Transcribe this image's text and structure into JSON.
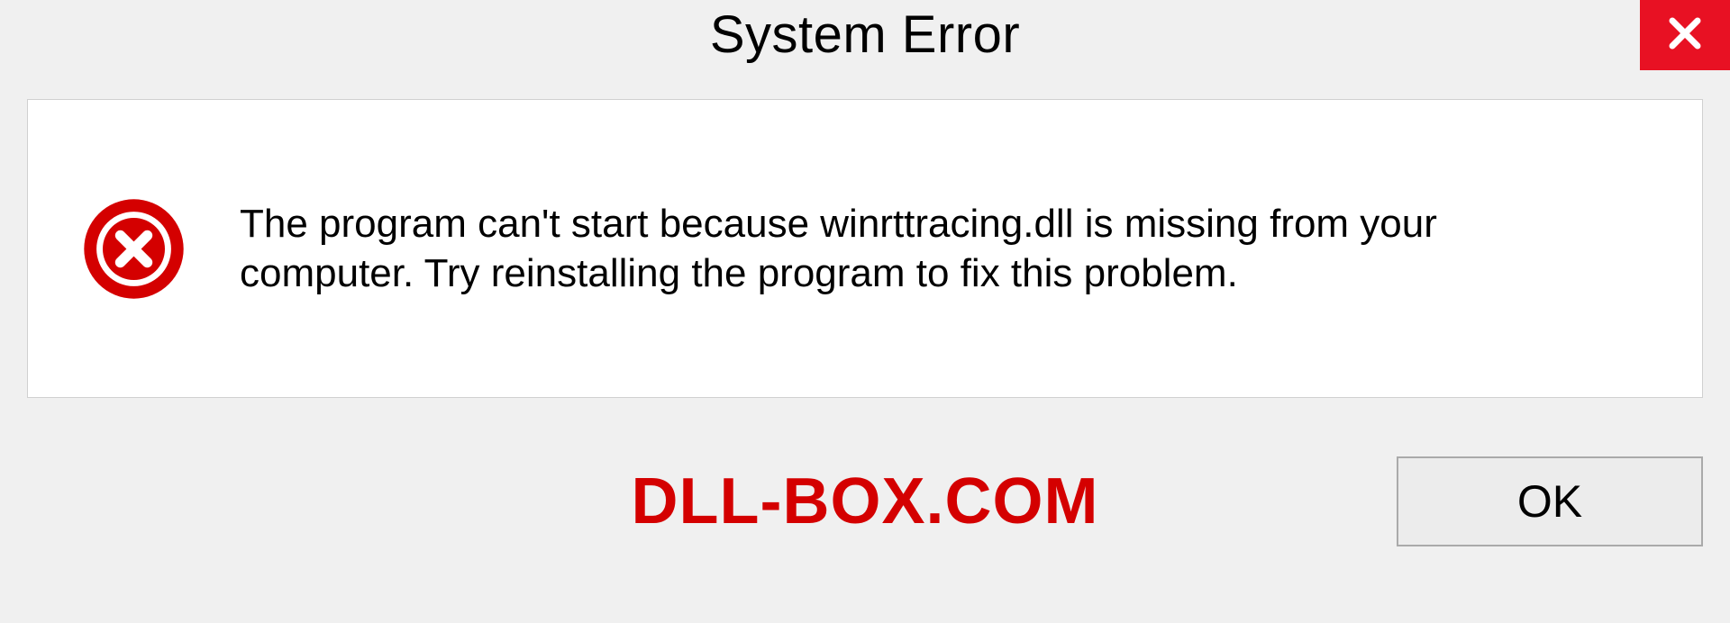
{
  "dialog": {
    "title": "System Error",
    "message": "The program can't start because winrttracing.dll is missing from your computer. Try reinstalling the program to fix this problem.",
    "ok_label": "OK"
  },
  "watermark": "DLL-BOX.COM",
  "colors": {
    "close_bg": "#e81123",
    "error_icon": "#d40000",
    "watermark": "#d40000"
  }
}
